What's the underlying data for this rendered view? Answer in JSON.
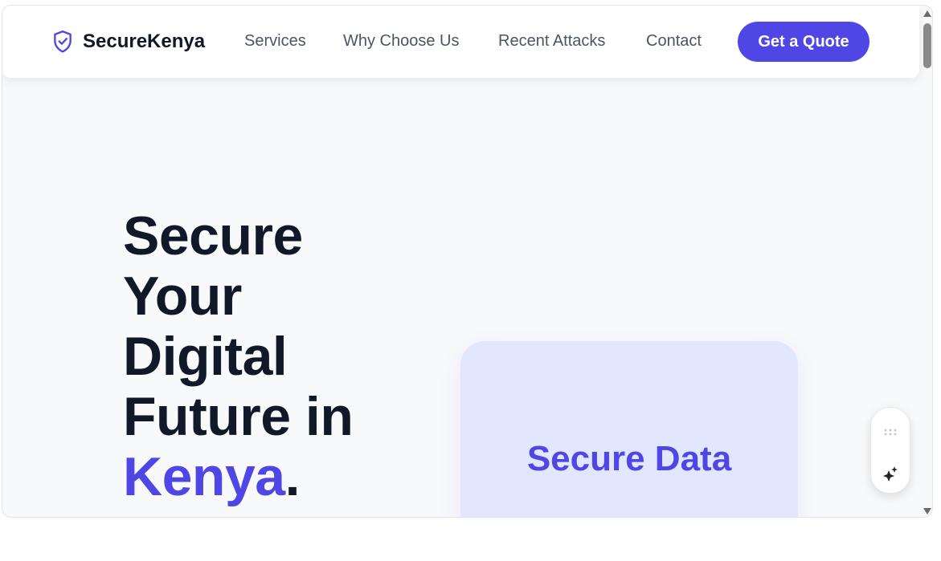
{
  "navbar": {
    "brand_name": "SecureKenya",
    "links": [
      "Services",
      "Why Choose Us",
      "Recent Attacks",
      "Contact"
    ],
    "cta_label": "Get a Quote"
  },
  "hero": {
    "title_lines": [
      "Secure",
      "Your",
      "Digital",
      "Future in"
    ],
    "title_accent": "Kenya",
    "title_end": "."
  },
  "card": {
    "label": "Secure Data"
  },
  "colors": {
    "accent": "#4f46e5",
    "card_bg": "#e0e7ff",
    "heading": "#111827"
  },
  "icons": {
    "brand": "shield-check-icon",
    "widget_top": "grip-dots-icon",
    "widget_bottom": "sparkle-icon"
  }
}
